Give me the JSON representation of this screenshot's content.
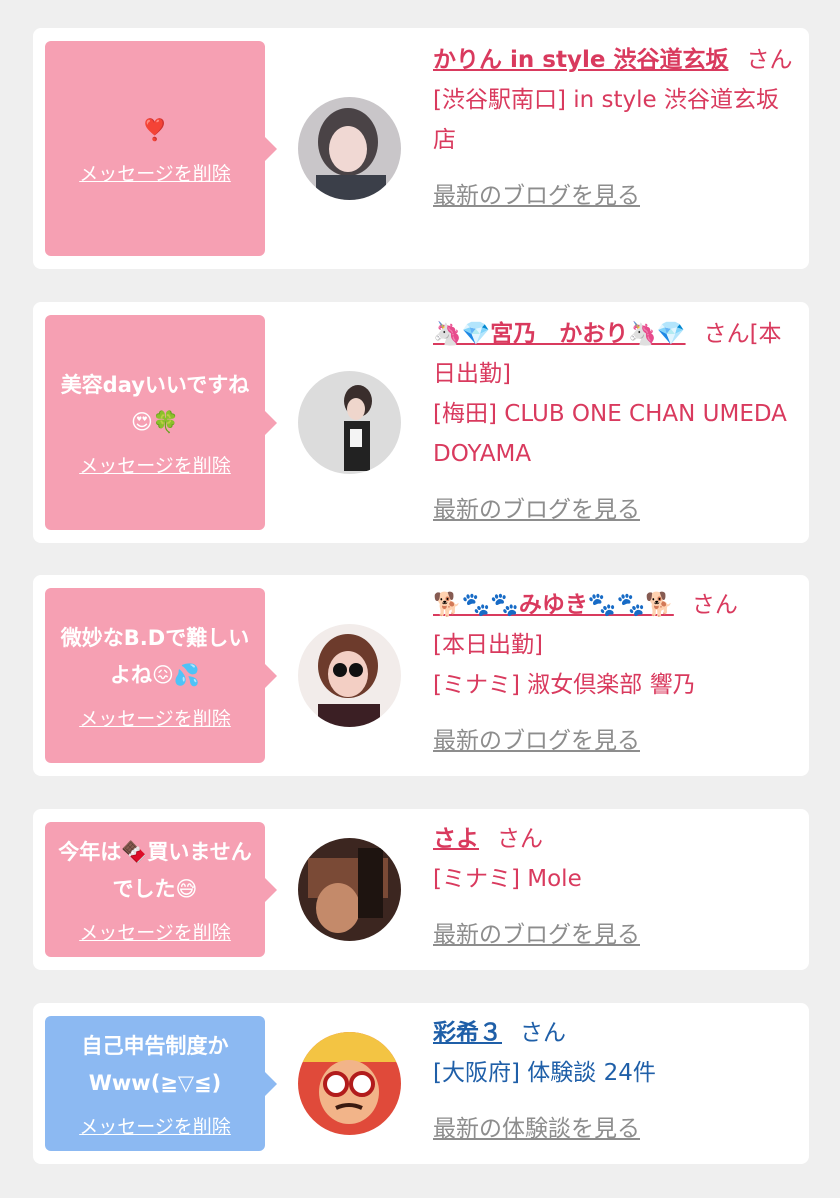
{
  "common": {
    "delete_label": "メッセージを削除",
    "san_label": "さん",
    "blog_label": "最新のブログを見る",
    "review_label": "最新の体験談を見る"
  },
  "colors": {
    "pink_bubble": "#f6a0b3",
    "blue_bubble": "#8cb9f2",
    "pink_text": "#d93a5e",
    "blue_text": "#1f5fa8",
    "link_gray": "#8d8d8d"
  },
  "cards": [
    {
      "message": "❣️",
      "name": "かりん in style 渋谷道玄坂",
      "lines": [
        "[渋谷駅南口] in style 渋谷道玄坂店"
      ]
    },
    {
      "message": "美容dayいいですね😍🍀",
      "name": "🦄💎宮乃　かおり🦄💎",
      "name_suffix": "[本日出勤]",
      "lines": [
        "[梅田] CLUB ONE CHAN UMEDA DOYAMA"
      ]
    },
    {
      "message": "微妙なB.Dで難しいよね😖💦",
      "name": "🐕🐾🐾みゆき🐾🐾🐕",
      "lines": [
        "[本日出勤]",
        "[ミナミ] 淑女倶楽部 響乃"
      ]
    },
    {
      "message": "今年は🍫買いませんでした😅",
      "name": "さよ",
      "lines": [
        "[ミナミ] Mole"
      ]
    },
    {
      "message": "自己申告制度かWww(≧▽≦)",
      "name": "彩希３",
      "lines": [
        "[大阪府] 体験談 24件"
      ]
    }
  ]
}
